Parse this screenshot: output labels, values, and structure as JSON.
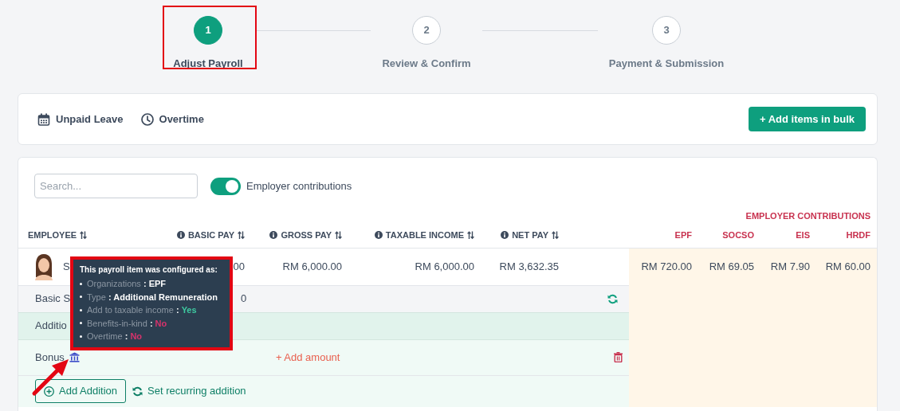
{
  "steps": [
    {
      "number": "1",
      "label": "Adjust Payroll",
      "selected": true
    },
    {
      "number": "2",
      "label": "Review & Confirm",
      "selected": false
    },
    {
      "number": "3",
      "label": "Payment & Submission",
      "selected": false
    }
  ],
  "toolbar": {
    "items": [
      {
        "label": "Unpaid Leave",
        "kind": "calendar"
      },
      {
        "label": "Overtime",
        "kind": "clock"
      }
    ],
    "bulk_button": "+ Add items in bulk"
  },
  "search": {
    "placeholder": "Search..."
  },
  "employer_toggle": {
    "label": "Employer contributions",
    "on": true
  },
  "employer_heading": "EMPLOYER CONTRIBUTIONS",
  "table": {
    "columns": [
      {
        "label": "EMPLOYEE",
        "kind": "employee",
        "info": false
      },
      {
        "label": "BASIC PAY",
        "kind": "pay",
        "info": true
      },
      {
        "label": "GROSS PAY",
        "kind": "pay",
        "info": true
      },
      {
        "label": "TAXABLE INCOME",
        "kind": "pay",
        "info": true
      },
      {
        "label": "NET PAY",
        "kind": "pay",
        "info": true
      },
      {
        "label": "EPF",
        "kind": "employer",
        "info": false
      },
      {
        "label": "SOCSO",
        "kind": "employer",
        "info": false
      },
      {
        "label": "EIS",
        "kind": "employer",
        "info": false
      },
      {
        "label": "HRDF",
        "kind": "employer",
        "info": false
      }
    ],
    "rows": [
      {
        "cells": [
          "S",
          "00",
          "RM 6,000.00",
          "RM 6,000.00",
          "RM 3,632.35",
          "RM 720.00",
          "RM 69.05",
          "RM 7.90",
          "RM 60.00"
        ]
      }
    ]
  },
  "basic_row": {
    "label": "Basic S",
    "amount": "0"
  },
  "additions": {
    "heading": "Additio",
    "items": [
      {
        "name": "Bonus",
        "add_amount": "+ Add amount"
      }
    ],
    "add_button": "Add Addition",
    "recurring_link": "Set recurring addition"
  },
  "tooltip": {
    "title": "This payroll item was configured as:",
    "separator": ":",
    "items": [
      {
        "label": "Organizations",
        "value": "EPF",
        "color": "#ffffff"
      },
      {
        "label": "Type",
        "value": "Additional Remuneration",
        "color": "#ffffff"
      },
      {
        "label": "Add to taxable income",
        "value": "Yes",
        "color": "#3ec9a0"
      },
      {
        "label": "Benefits-in-kind",
        "value": "No",
        "color": "#d6336c"
      },
      {
        "label": "Overtime",
        "value": "No",
        "color": "#d6336c"
      }
    ]
  }
}
